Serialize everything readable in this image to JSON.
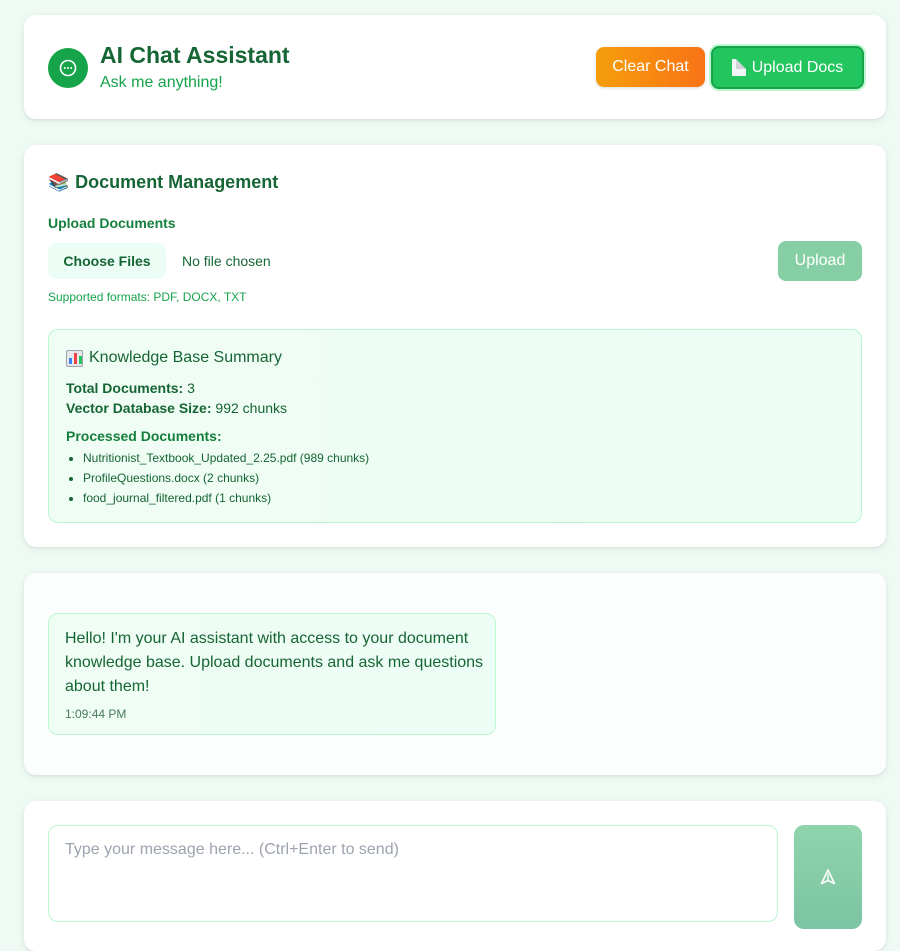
{
  "header": {
    "title": "AI Chat Assistant",
    "subtitle": "Ask me anything!",
    "clear_label": "Clear Chat",
    "upload_docs_label": "Upload Docs"
  },
  "docs": {
    "section_title": "Document Management",
    "upload_label": "Upload Documents",
    "choose_files_label": "Choose Files",
    "no_file_text": "No file chosen",
    "upload_button_label": "Upload",
    "formats_text": "Supported formats: PDF, DOCX, TXT",
    "summary": {
      "title": "Knowledge Base Summary",
      "total_label": "Total Documents:",
      "total_value": "3",
      "size_label": "Vector Database Size:",
      "size_value": "992 chunks",
      "processed_label": "Processed Documents:",
      "documents": [
        "Nutritionist_Textbook_Updated_2.25.pdf (989 chunks)",
        "ProfileQuestions.docx (2 chunks)",
        "food_journal_filtered.pdf (1 chunks)"
      ]
    }
  },
  "chat": {
    "messages": [
      {
        "text": "Hello! I'm your AI assistant with access to your document knowledge base. Upload documents and ask me questions about them!",
        "time": "1:09:44 PM"
      }
    ]
  },
  "input": {
    "placeholder": "Type your message here... (Ctrl+Enter to send)"
  },
  "colors": {
    "primary": "#16a34a",
    "clear_button": "#f97316",
    "background": "#eefaf3"
  },
  "icons": {
    "app": "chat-bubble-icon",
    "docs_section": "books-icon",
    "summary": "bar-chart-icon",
    "send": "send-icon",
    "upload_docs": "document-icon"
  }
}
